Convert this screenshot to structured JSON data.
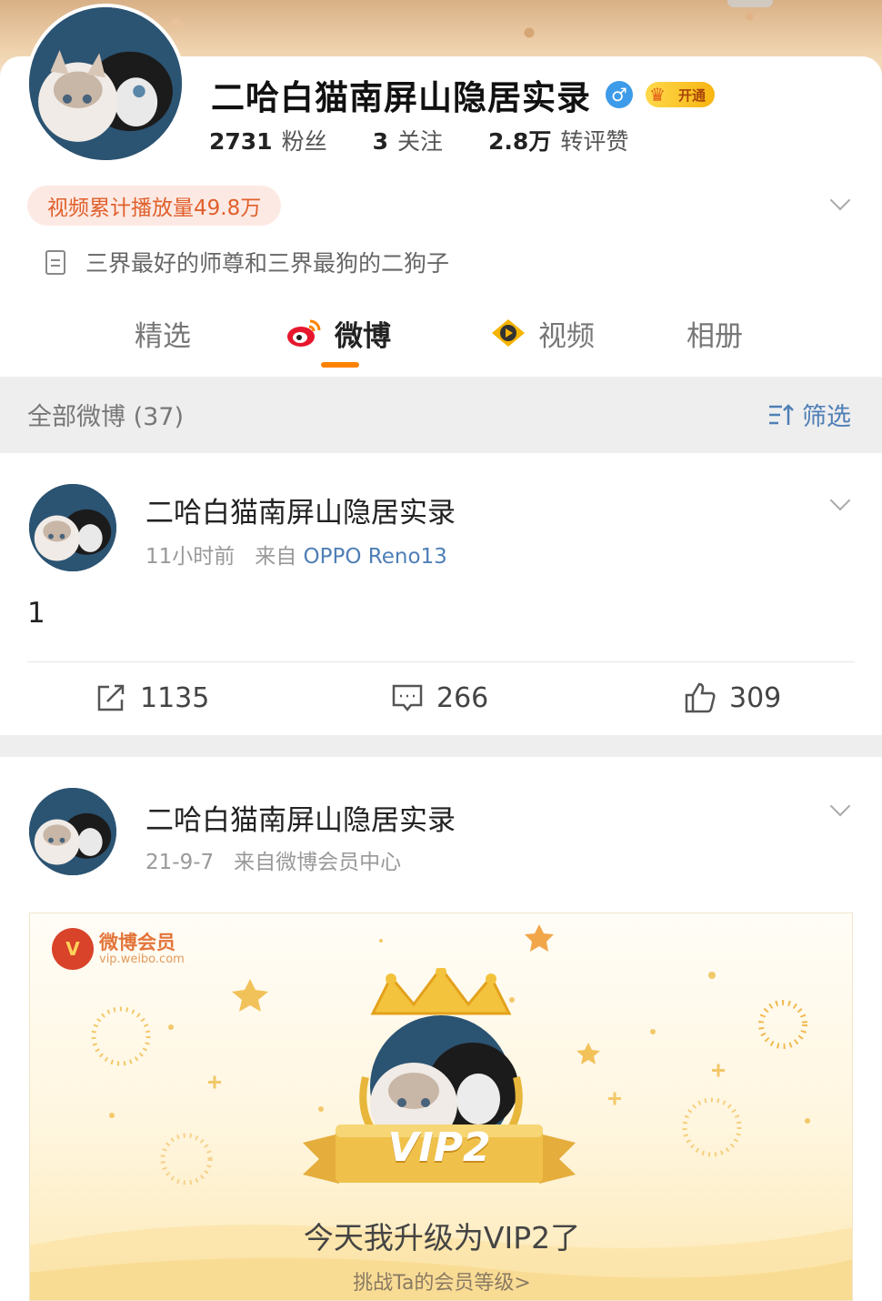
{
  "profile": {
    "name": "二哈白猫南屏山隐居实录",
    "gender_symbol": "♂",
    "vip_badge": "开通",
    "stats": [
      {
        "value": "2731",
        "label": "粉丝"
      },
      {
        "value": "3",
        "label": "关注"
      },
      {
        "value": "2.8万",
        "label": "转评赞"
      }
    ],
    "play_count": "视频累计播放量49.8万",
    "bio": "三界最好的师尊和三界最狗的二狗子"
  },
  "tabs": [
    {
      "label": "精选",
      "active": false
    },
    {
      "label": "微博",
      "active": true
    },
    {
      "label": "视频",
      "active": false
    },
    {
      "label": "相册",
      "active": false
    }
  ],
  "filter": {
    "title": "全部微博 (37)",
    "button": "筛选"
  },
  "posts": [
    {
      "name": "二哈白猫南屏山隐居实录",
      "time": "11小时前",
      "from_prefix": "来自",
      "source": "OPPO Reno13",
      "body": "1",
      "reposts": "1135",
      "comments": "266",
      "likes": "309"
    },
    {
      "name": "二哈白猫南屏山隐居实录",
      "time": "21-9-7",
      "from_prefix": "来自",
      "source": "微博会员中心",
      "vip_card": {
        "logo_title": "微博会员",
        "logo_url_text": "vip.weibo.com",
        "level": "VIP2",
        "message": "今天我升级为VIP2了",
        "link": "挑战Ta的会员等级>"
      }
    }
  ],
  "colors": {
    "accent_orange": "#ff8200",
    "link_blue": "#4f7fb6",
    "gender_blue": "#3d9be9"
  }
}
